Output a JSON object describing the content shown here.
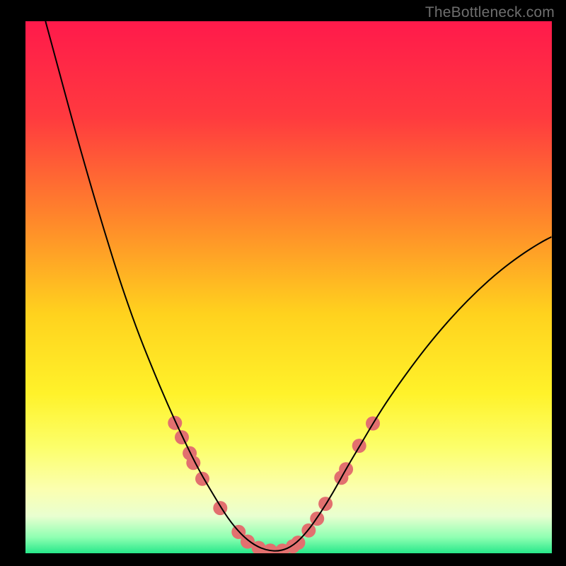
{
  "watermark": "TheBottleneck.com",
  "chart_data": {
    "type": "line",
    "title": "",
    "xlabel": "",
    "ylabel": "",
    "xlim": [
      0,
      100
    ],
    "ylim": [
      0,
      100
    ],
    "background_gradient_stops": [
      {
        "offset": 0,
        "color": "#ff1a4b"
      },
      {
        "offset": 18,
        "color": "#ff3a3f"
      },
      {
        "offset": 38,
        "color": "#ff8a2a"
      },
      {
        "offset": 55,
        "color": "#ffd21e"
      },
      {
        "offset": 70,
        "color": "#fff22a"
      },
      {
        "offset": 80,
        "color": "#fcff6a"
      },
      {
        "offset": 88,
        "color": "#fbffb0"
      },
      {
        "offset": 93,
        "color": "#e9ffd0"
      },
      {
        "offset": 97,
        "color": "#8fffb2"
      },
      {
        "offset": 100,
        "color": "#27e88a"
      }
    ],
    "series": [
      {
        "name": "curve",
        "stroke": "#000000",
        "stroke_width": 2,
        "points": [
          {
            "x": 3.8,
            "y": 100.0
          },
          {
            "x": 6.0,
            "y": 92.0
          },
          {
            "x": 9.0,
            "y": 81.0
          },
          {
            "x": 12.0,
            "y": 70.5
          },
          {
            "x": 15.0,
            "y": 60.5
          },
          {
            "x": 18.0,
            "y": 51.0
          },
          {
            "x": 21.0,
            "y": 42.5
          },
          {
            "x": 24.0,
            "y": 35.0
          },
          {
            "x": 27.0,
            "y": 28.0
          },
          {
            "x": 30.0,
            "y": 21.5
          },
          {
            "x": 33.0,
            "y": 15.5
          },
          {
            "x": 36.0,
            "y": 10.5
          },
          {
            "x": 38.5,
            "y": 6.5
          },
          {
            "x": 41.0,
            "y": 3.5
          },
          {
            "x": 43.5,
            "y": 1.5
          },
          {
            "x": 46.0,
            "y": 0.5
          },
          {
            "x": 48.5,
            "y": 0.4
          },
          {
            "x": 51.0,
            "y": 1.5
          },
          {
            "x": 53.5,
            "y": 4.0
          },
          {
            "x": 56.0,
            "y": 7.5
          },
          {
            "x": 58.5,
            "y": 11.5
          },
          {
            "x": 61.0,
            "y": 16.0
          },
          {
            "x": 64.0,
            "y": 21.0
          },
          {
            "x": 67.0,
            "y": 26.0
          },
          {
            "x": 70.0,
            "y": 30.5
          },
          {
            "x": 74.0,
            "y": 36.0
          },
          {
            "x": 78.0,
            "y": 41.0
          },
          {
            "x": 82.0,
            "y": 45.5
          },
          {
            "x": 86.0,
            "y": 49.5
          },
          {
            "x": 90.0,
            "y": 53.0
          },
          {
            "x": 94.0,
            "y": 56.0
          },
          {
            "x": 98.0,
            "y": 58.5
          },
          {
            "x": 100.0,
            "y": 59.5
          }
        ]
      }
    ],
    "markers": {
      "color": "#e2706f",
      "radius": 10,
      "points": [
        {
          "x": 28.4,
          "y": 24.5
        },
        {
          "x": 29.7,
          "y": 21.8
        },
        {
          "x": 31.2,
          "y": 18.8
        },
        {
          "x": 31.9,
          "y": 17.0
        },
        {
          "x": 33.6,
          "y": 14.0
        },
        {
          "x": 37.0,
          "y": 8.5
        },
        {
          "x": 40.5,
          "y": 4.0
        },
        {
          "x": 42.2,
          "y": 2.2
        },
        {
          "x": 44.3,
          "y": 1.0
        },
        {
          "x": 46.5,
          "y": 0.5
        },
        {
          "x": 48.8,
          "y": 0.5
        },
        {
          "x": 50.8,
          "y": 1.3
        },
        {
          "x": 51.8,
          "y": 2.0
        },
        {
          "x": 53.8,
          "y": 4.3
        },
        {
          "x": 55.4,
          "y": 6.5
        },
        {
          "x": 57.0,
          "y": 9.3
        },
        {
          "x": 60.0,
          "y": 14.2
        },
        {
          "x": 60.9,
          "y": 15.8
        },
        {
          "x": 63.4,
          "y": 20.2
        },
        {
          "x": 66.0,
          "y": 24.4
        }
      ]
    }
  }
}
